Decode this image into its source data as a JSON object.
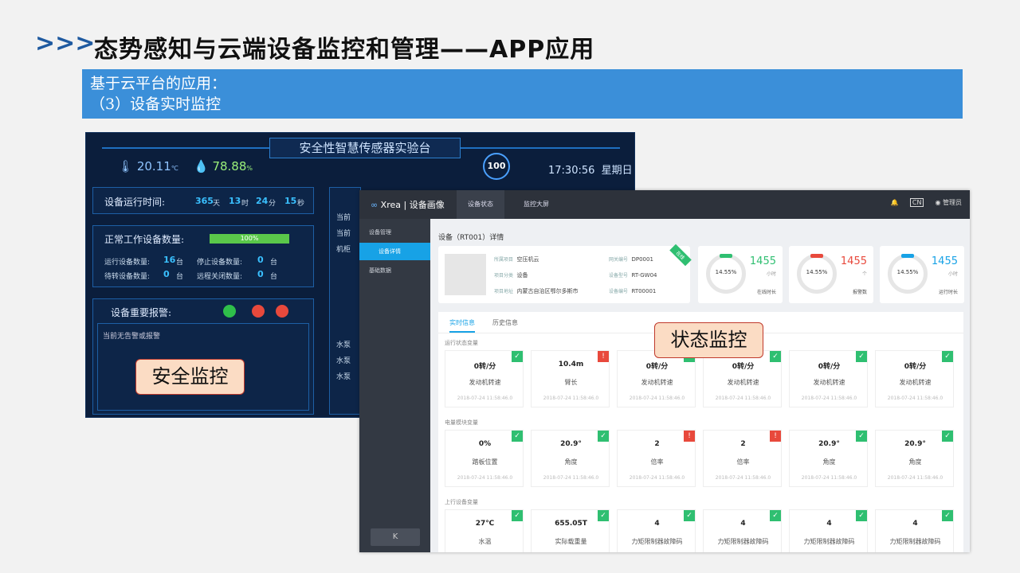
{
  "slide": {
    "chevrons": ">>>",
    "title": "态势感知与云端设备监控和管理——APP应用",
    "subtitle_line1": "基于云平台的应用：",
    "subtitle_line2": "（3）设备实时监控"
  },
  "dashboard": {
    "title": "安全性智慧传感器实验台",
    "temp": "20.11",
    "temp_unit": "℃",
    "humidity": "78.88",
    "humidity_unit": "%",
    "badge": "100",
    "time": "17:30:56",
    "weekday": "星期日",
    "runtime_label": "设备运行时间:",
    "runtime_days": "365",
    "runtime_days_unit": "天",
    "runtime_h": "13",
    "runtime_h_unit": "时",
    "runtime_m": "24",
    "runtime_m_unit": "分",
    "runtime_s": "15",
    "runtime_s_unit": "秒",
    "normal_label": "正常工作设备数量:",
    "normal_progress_label": "100%",
    "normal_progress": 1.0,
    "running_label": "运行设备数量:",
    "running_value": "16",
    "stopped_label": "停止设备数量:",
    "stopped_value": "0",
    "waiting_label": "待转设备数量:",
    "waiting_value": "0",
    "remote_label": "远程关闭数量:",
    "remote_value": "0",
    "unit_tai": "台",
    "alarm_label": "设备重要报警:",
    "alarm_text": "当前无告警或报警",
    "right_labels": [
      "当前",
      "当前",
      "机柜",
      "水泵",
      "水泵",
      "水泵"
    ],
    "alarm_colors": [
      "#2fbf4a",
      "#e8493c",
      "#e8493c"
    ],
    "callout": "安全监控"
  },
  "status_callout": "状态监控",
  "app": {
    "logo_sym": "∞",
    "logo": "Xrea",
    "logo_sep": "|",
    "app_name": "设备画像",
    "nav_active": "设备状态",
    "nav_other": "监控大屏",
    "lang": "CN",
    "user": "管理员",
    "side_mgmt": "设备管理",
    "side_detail": "设备详情",
    "side_basic": "基础数据",
    "collapse": "K",
    "crumb": "设备（RT001）详情",
    "ribbon": "在线",
    "info": {
      "project_k": "所属项目",
      "project_v": "空压机云",
      "gateway_k": "网关编号",
      "gateway_v": "DP0001",
      "cat_k": "项目分类",
      "cat_v": "设备",
      "model_k": "设备型号",
      "model_v": "RT-GW04",
      "addr_k": "项目地址",
      "addr_v": "内蒙古自治区鄂尔多斯市",
      "dev_k": "设备编号",
      "dev_v": "RT00001"
    },
    "stats": [
      {
        "pct": "14.55%",
        "num": "1455",
        "unit": "小时",
        "cap": "在线时长",
        "color": "#2fbf71"
      },
      {
        "pct": "14.55%",
        "num": "1455",
        "unit": "个",
        "cap": "报警数",
        "color": "#e8493c"
      },
      {
        "pct": "14.55%",
        "num": "1455",
        "unit": "小时",
        "cap": "运行时长",
        "color": "#17a2e6"
      }
    ],
    "tab_rt": "实时信息",
    "tab_hist": "历史信息",
    "sections": [
      "运行状态变量",
      "电量模块变量",
      "上行设备变量"
    ],
    "rows": [
      [
        {
          "v": "0转/分",
          "l": "发动机转速",
          "d": "2018-07-24 11:58:46.0",
          "s": "ok"
        },
        {
          "v": "10.4m",
          "l": "臂长",
          "d": "2018-07-24 11:58:46.0",
          "s": "bad"
        },
        {
          "v": "0转/分",
          "l": "发动机转速",
          "d": "2018-07-24 11:58:46.0",
          "s": "ok"
        },
        {
          "v": "0转/分",
          "l": "发动机转速",
          "d": "2018-07-24 11:58:46.0",
          "s": "ok"
        },
        {
          "v": "0转/分",
          "l": "发动机转速",
          "d": "2018-07-24 11:58:46.0",
          "s": "ok"
        },
        {
          "v": "0转/分",
          "l": "发动机转速",
          "d": "2018-07-24 11:58:46.0",
          "s": "ok"
        }
      ],
      [
        {
          "v": "0%",
          "l": "踏板位置",
          "d": "2018-07-24 11:58:46.0",
          "s": "ok"
        },
        {
          "v": "20.9°",
          "l": "角度",
          "d": "2018-07-24 11:58:46.0",
          "s": "ok"
        },
        {
          "v": "2",
          "l": "倍率",
          "d": "2018-07-24 11:58:46.0",
          "s": "bad"
        },
        {
          "v": "2",
          "l": "倍率",
          "d": "2018-07-24 11:58:46.0",
          "s": "bad"
        },
        {
          "v": "20.9°",
          "l": "角度",
          "d": "2018-07-24 11:58:46.0",
          "s": "ok"
        },
        {
          "v": "20.9°",
          "l": "角度",
          "d": "2018-07-24 11:58:46.0",
          "s": "ok"
        }
      ],
      [
        {
          "v": "27℃",
          "l": "水温",
          "d": "",
          "s": "ok"
        },
        {
          "v": "655.05T",
          "l": "实际载重量",
          "d": "",
          "s": "ok"
        },
        {
          "v": "4",
          "l": "力矩限制器故障码",
          "d": "",
          "s": "ok"
        },
        {
          "v": "4",
          "l": "力矩限制器故障码",
          "d": "",
          "s": "ok"
        },
        {
          "v": "4",
          "l": "力矩限制器故障码",
          "d": "",
          "s": "ok"
        },
        {
          "v": "4",
          "l": "力矩限制器故障码",
          "d": "",
          "s": "ok"
        }
      ]
    ]
  }
}
